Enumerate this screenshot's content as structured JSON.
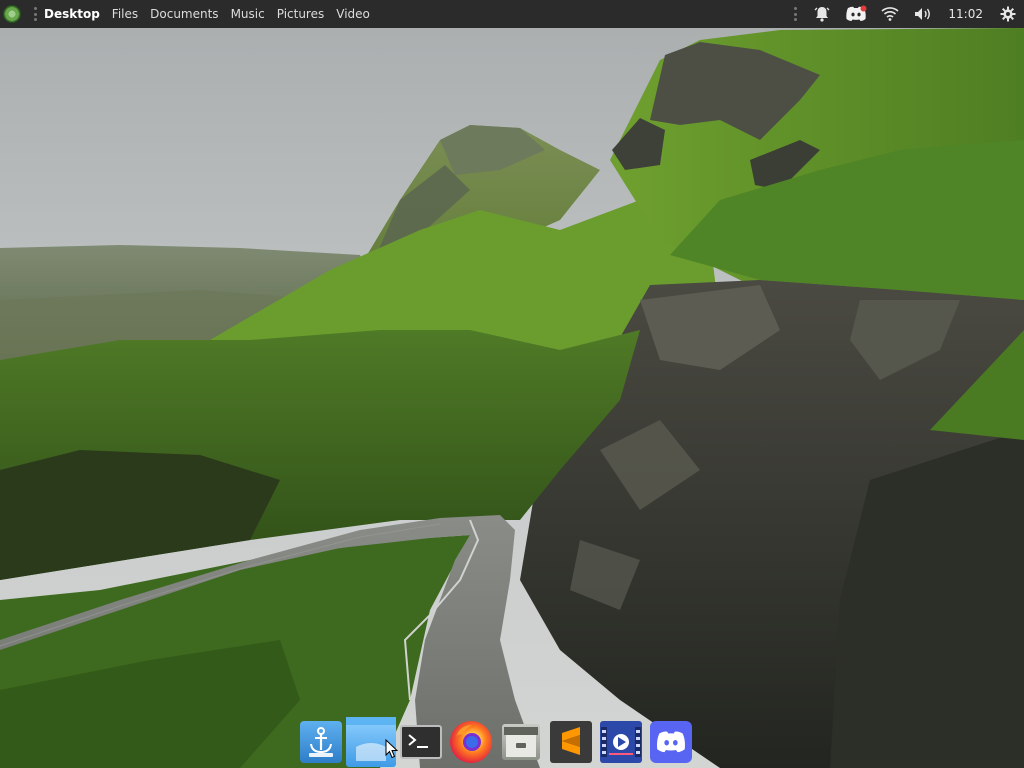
{
  "panel": {
    "menu_icon": "ubuntu-budgie-logo-icon",
    "places": [
      {
        "label": "Desktop",
        "active": true
      },
      {
        "label": "Files",
        "active": false
      },
      {
        "label": "Documents",
        "active": false
      },
      {
        "label": "Music",
        "active": false
      },
      {
        "label": "Pictures",
        "active": false
      },
      {
        "label": "Video",
        "active": false
      }
    ],
    "tray": {
      "notifications_icon": "bell-icon",
      "discord_icon": "discord-icon",
      "wifi_icon": "wifi-icon",
      "volume_icon": "volume-icon",
      "clock": "11:02",
      "settings_icon": "gear-icon"
    }
  },
  "dock": {
    "items": [
      {
        "name": "plank-dock-settings",
        "icon": "anchor-icon",
        "color": "#3d8fd8"
      },
      {
        "name": "files",
        "icon": "folder-icon",
        "color": "#4aa3e8",
        "active": true
      },
      {
        "name": "terminal",
        "icon": "terminal-icon",
        "color": "#2b2b2b"
      },
      {
        "name": "firefox",
        "icon": "firefox-icon",
        "color": "#ff7139"
      },
      {
        "name": "archive-manager",
        "icon": "archive-icon",
        "color": "#8a8f84"
      },
      {
        "name": "sublime-text",
        "icon": "sublime-icon",
        "color": "#ff9800"
      },
      {
        "name": "video-player",
        "icon": "film-icon",
        "color": "#3a64c8"
      },
      {
        "name": "discord",
        "icon": "discord-icon",
        "color": "#5865f2"
      }
    ]
  },
  "colors": {
    "panel_bg": "#2b2b2b",
    "panel_text": "#dcdcdc",
    "sky": "#b8bcbd",
    "grass": "#5f8a2c"
  }
}
